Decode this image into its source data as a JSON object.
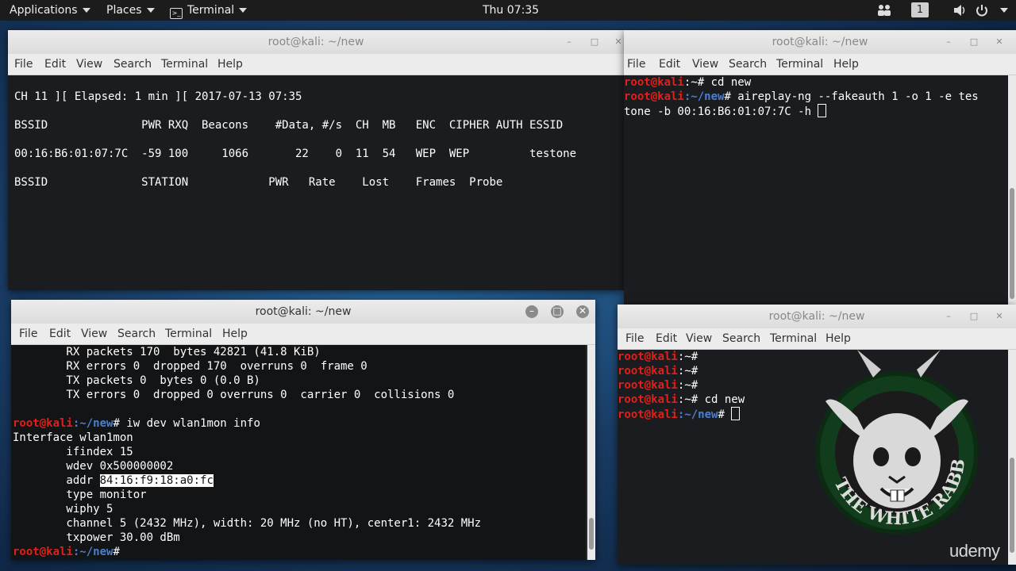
{
  "topbar": {
    "applications": "Applications",
    "places": "Places",
    "terminal": "Terminal",
    "clock": "Thu 07:35",
    "workspace": "1"
  },
  "menus": [
    "File",
    "Edit",
    "View",
    "Search",
    "Terminal",
    "Help"
  ],
  "windows": {
    "airodump": {
      "title": "root@kali: ~/new",
      "lines": [
        "CH 11 ][ Elapsed: 1 min ][ 2017-07-13 07:35",
        "BSSID              PWR RXQ  Beacons    #Data, #/s  CH  MB   ENC  CIPHER AUTH ESSID",
        "00:16:B6:01:07:7C  -59 100     1066       22    0  11  54   WEP  WEP         testone",
        "BSSID              STATION            PWR   Rate    Lost    Frames  Probe"
      ]
    },
    "aireplay": {
      "title": "root@kali: ~/new",
      "prompt_root": "root@kali",
      "line1_path": ":~",
      "line1_cmd": "# cd new",
      "line2_path": ":~/new",
      "line2_cmd": "# aireplay-ng --fakeauth 1 -o 1 -e tes",
      "line3": "tone -b 00:16:B6:01:07:7C -h "
    },
    "iw": {
      "title": "root@kali: ~/new",
      "lines_top": [
        "        RX packets 170  bytes 42821 (41.8 KiB)",
        "        RX errors 0  dropped 170  overruns 0  frame 0",
        "        TX packets 0  bytes 0 (0.0 B)",
        "        TX errors 0  dropped 0 overruns 0  carrier 0  collisions 0"
      ],
      "prompt_root": "root@kali",
      "prompt_path": ":~/new",
      "command": "# iw dev wlan1mon info",
      "info": [
        "Interface wlan1mon",
        "        ifindex 15",
        "        wdev 0x500000002"
      ],
      "addr_label": "        addr ",
      "addr_value": "84:16:f9:18:a0:fc",
      "info2": [
        "        type monitor",
        "        wiphy 5",
        "        channel 5 (2432 MHz), width: 20 MHz (no HT), center1: 2432 MHz",
        "        txpower 30.00 dBm"
      ],
      "final_prompt_suffix": "#"
    },
    "idle": {
      "title": "root@kali: ~/new",
      "prompt_root": "root@kali",
      "p1": ":~",
      "p1cmd": "#",
      "p4cmd": "# cd new",
      "p5": ":~/new",
      "p5cmd": "# "
    }
  },
  "watermark": "udemy",
  "logo_text": "THE WHITE RABBIT"
}
